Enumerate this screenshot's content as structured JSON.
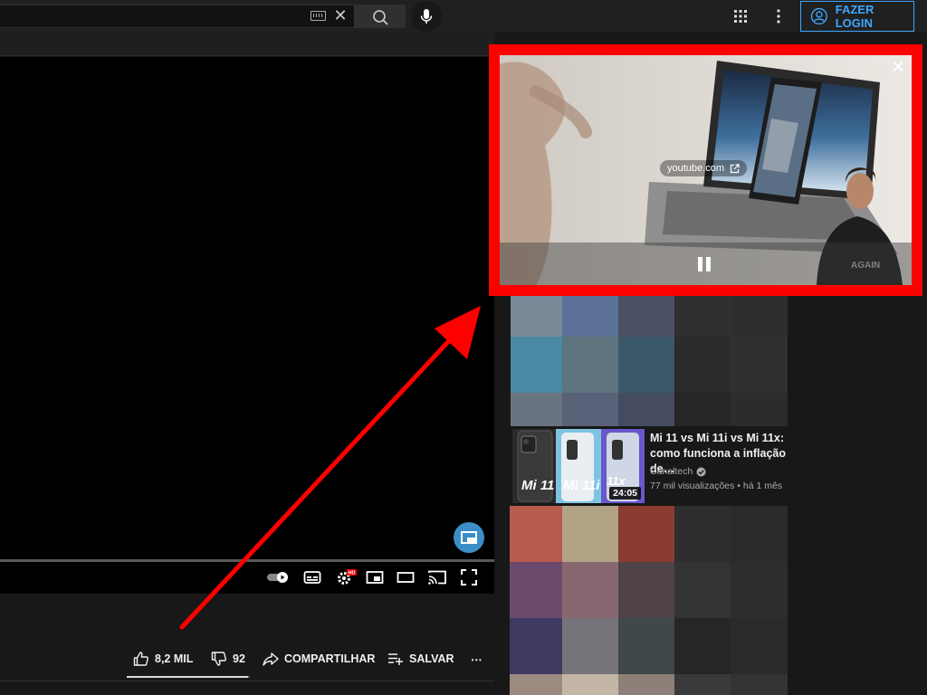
{
  "search": {
    "value": "",
    "placeholder": ""
  },
  "header": {
    "login_label": "FAZER LOGIN"
  },
  "actions": {
    "likes": "8,2 MIL",
    "dislikes": "92",
    "share_label": "COMPARTILHAR",
    "save_label": "SALVAR",
    "more_label": "⋯"
  },
  "mini_player": {
    "url_label": "youtube.com",
    "close_label": "✕"
  },
  "recommended": {
    "title": "Mi 11 vs Mi 11i vs Mi 11x: como funciona a inflação de…",
    "channel": "Canaltech",
    "meta": "77 mil visualizações • há 1 mês",
    "duration": "24:05",
    "thumb_labels": [
      "Mi 11",
      "Mi 11i",
      "11x"
    ]
  },
  "colors": {
    "accent": "#3ea6ff",
    "highlight": "#ff0000",
    "background": "#181818"
  }
}
